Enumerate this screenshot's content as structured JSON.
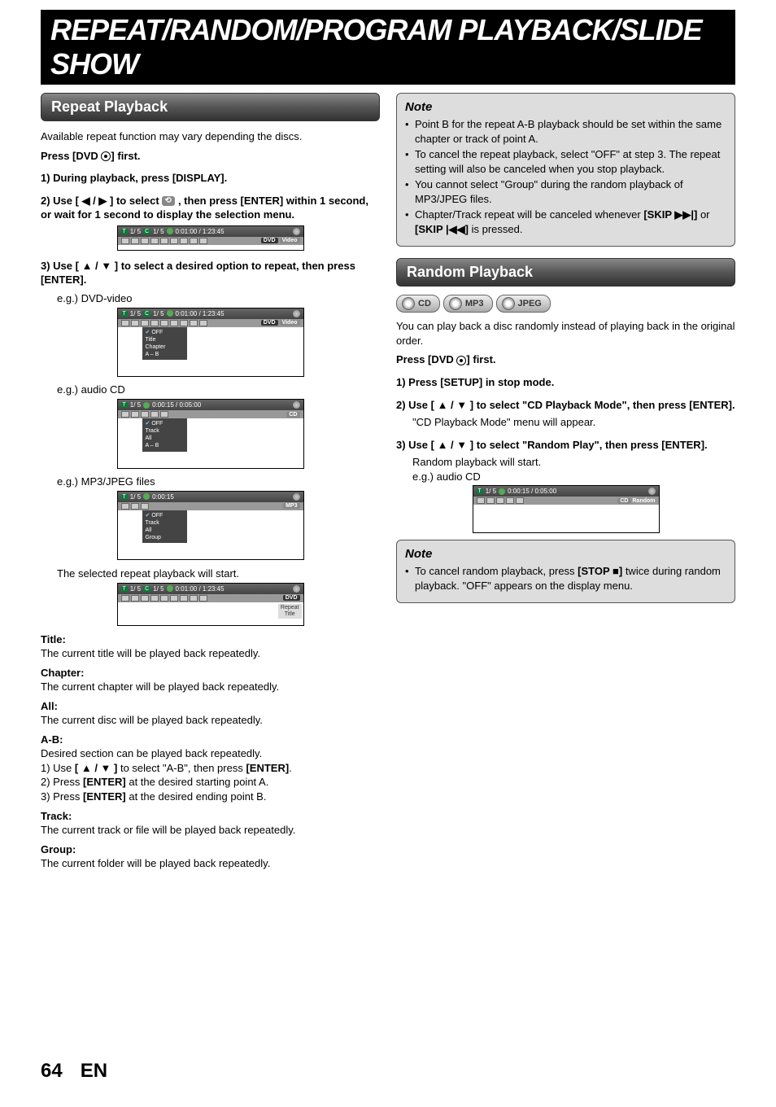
{
  "mainTitle": "REPEAT/RANDOM/PROGRAM PLAYBACK/SLIDE SHOW",
  "pageNumber": "64",
  "pageLang": "EN",
  "left": {
    "sectionTitle": "Repeat Playback",
    "intro": "Available repeat function may vary depending the discs.",
    "pressFirst": "Press [DVD ⊚] first.",
    "step1": "1) During playback, press [DISPLAY].",
    "step2_a": "2) Use [ ◀ / ▶ ] to select",
    "step2_b": ", then press [ENTER] within 1 second, or wait for 1 second to display the selection menu.",
    "step3": "3) Use [ ▲ / ▼ ] to select a desired option to repeat, then press [ENTER].",
    "eg_dvd": "e.g.) DVD-video",
    "eg_cd": "e.g.) audio CD",
    "eg_mp3": "e.g.) MP3/JPEG files",
    "selected_start": "The selected repeat playback will start.",
    "osd1": {
      "counter": "1/  5",
      "chap": "1/  5",
      "time": "0:01:00 / 1:23:45",
      "badge1": "DVD",
      "badge2": "Video"
    },
    "osd2": {
      "counter": "1/  5",
      "chap": "1/  5",
      "time": "0:01:00 / 1:23:45",
      "badge1": "DVD",
      "badge2": "Video",
      "menu": [
        "OFF",
        "Title",
        "Chapter",
        "A – B"
      ]
    },
    "osd3": {
      "counter": "1/  5",
      "time": "0:00:15 / 0:05:00",
      "badge1": "CD",
      "menu": [
        "OFF",
        "Track",
        "All",
        "A – B"
      ]
    },
    "osd4": {
      "counter": "1/  5",
      "time": "0:00:15",
      "badge1": "MP3",
      "menu": [
        "OFF",
        "Track",
        "All",
        "Group"
      ]
    },
    "osd5": {
      "counter": "1/  5",
      "chap": "1/  5",
      "time": "0:01:00 / 1:23:45",
      "badge1": "DVD",
      "status1": "Repeat",
      "status2": "Title"
    },
    "defs": {
      "title_h": "Title:",
      "title_t": "The current title will be played back repeatedly.",
      "chapter_h": "Chapter:",
      "chapter_t": "The current chapter will be played back repeatedly.",
      "all_h": "All:",
      "all_t": "The current disc will be played back repeatedly.",
      "ab_h": "A-B:",
      "ab_t": "Desired section can be played back repeatedly.",
      "ab_1": "1) Use [ ▲ / ▼ ] to select \"A-B\", then press [ENTER].",
      "ab_2": "2) Press [ENTER] at the desired starting point A.",
      "ab_3": "3) Press [ENTER] at the desired ending point B.",
      "track_h": "Track:",
      "track_t": "The current track or file will be played back repeatedly.",
      "group_h": "Group:",
      "group_t": "The current folder will be played back repeatedly."
    }
  },
  "right": {
    "note1_title": "Note",
    "note1": [
      "Point B for the repeat A-B playback should be set within the same chapter or track of point A.",
      "To cancel the repeat playback, select \"OFF\" at step 3. The repeat setting will also be canceled when you stop playback.",
      "You cannot select \"Group\" during the random playback of MP3/JPEG files.",
      "Chapter/Track repeat will be canceled whenever [SKIP ▶▶|] or [SKIP |◀◀] is pressed."
    ],
    "sectionTitle": "Random Playback",
    "badges": [
      "CD",
      "MP3",
      "JPEG"
    ],
    "intro": "You can play back a disc randomly instead of playing back in the original order.",
    "pressFirst": "Press [DVD ⊚] first.",
    "step1": "1) Press [SETUP] in stop mode.",
    "step2": "2) Use [ ▲ / ▼ ] to select \"CD Playback Mode\", then press [ENTER].",
    "step2_sub": "\"CD Playback Mode\" menu will appear.",
    "step3": "3) Use [ ▲ / ▼ ] to select \"Random Play\", then press [ENTER].",
    "step3_sub1": "Random playback will start.",
    "step3_sub2": "e.g.) audio CD",
    "osd6": {
      "counter": "1/  5",
      "time": "0:00:15 / 0:05:00",
      "badge1": "CD",
      "status1": "Random"
    },
    "note2_title": "Note",
    "note2": [
      "To cancel random playback, press [STOP ■] twice during random playback. \"OFF\" appears on the display menu."
    ]
  }
}
